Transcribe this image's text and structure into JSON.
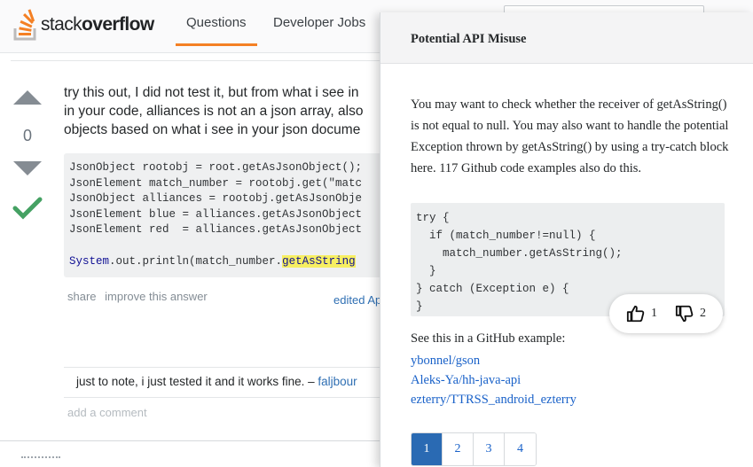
{
  "header": {
    "logo_light": "stack",
    "logo_bold": "overflow",
    "tabs": [
      {
        "label": "Questions",
        "active": true
      },
      {
        "label": "Developer Jobs",
        "active": false
      }
    ],
    "accent_color": "#f48024"
  },
  "answer": {
    "votes": "0",
    "accepted": true,
    "text_lines": [
      "try this out, I did not test it, but from what i see in",
      "in your code, alliances is not an a json array, also",
      "objects based on what i see in your json docume"
    ],
    "code_lines": [
      "JsonObject rootobj = root.getAsJsonObject();",
      "JsonElement match_number = rootobj.get(\"matc",
      "JsonObject alliances = rootobj.getAsJsonObje",
      "JsonElement blue = alliances.getAsJsonObject",
      "JsonElement red  = alliances.getAsJsonObject",
      "",
      "System.out.println(match_number.getAsString"
    ],
    "highlight_text": "getAsString",
    "share_label": "share",
    "improve_label": "improve this answer",
    "edited_label": "edited Ap",
    "comment_text": "just to note, i just tested it and it works fine. – ",
    "comment_user": "faljbour",
    "add_comment_label": "add a comment"
  },
  "popup": {
    "title": "Potential API Misuse",
    "message": "You may want to check whether the receiver of getAsString() is not equal to null. You may also want to handle the potential Exception thrown by getAsString() by using a try-catch block here. 117 Github code examples also do this.",
    "code_lines": [
      "try {",
      "  if (match_number!=null) {",
      "    match_number.getAsString();",
      "  }",
      "} catch (Exception e) {",
      "}"
    ],
    "thumbs_up_count": "1",
    "thumbs_down_count": "2",
    "see_example_label": "See this in a GitHub example:",
    "github_links": [
      "ybonnel/gson",
      "Aleks-Ya/hh-java-api",
      "ezterry/TTRSS_android_ezterry"
    ],
    "pages": [
      "1",
      "2",
      "3",
      "4"
    ],
    "active_page": "1"
  }
}
